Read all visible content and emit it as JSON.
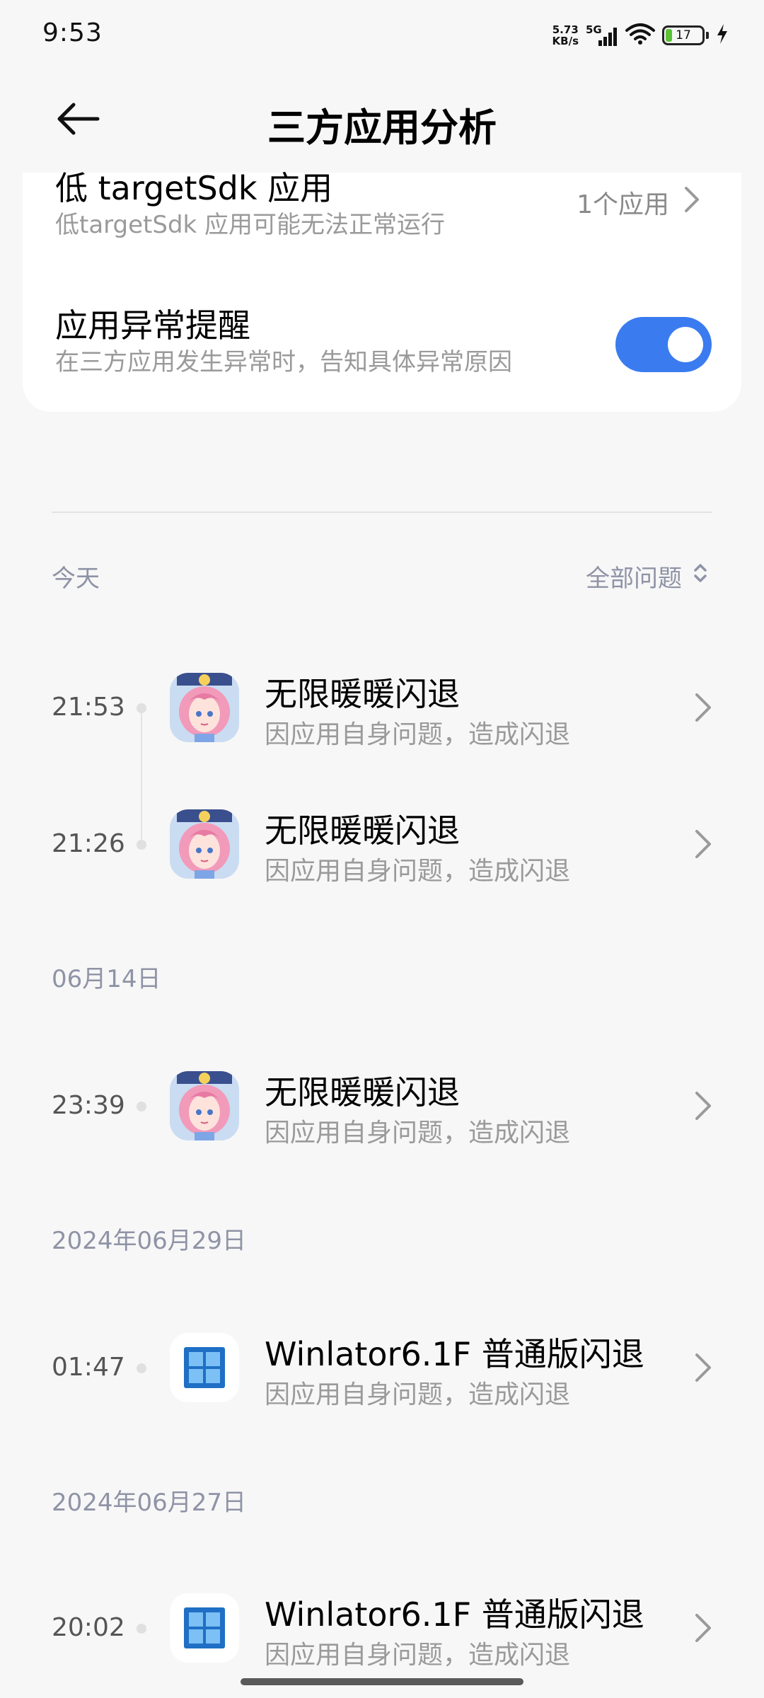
{
  "status_bar": {
    "time": "9:53",
    "net_speed_value": "5.73",
    "net_speed_unit": "KB/s",
    "network": "5G",
    "battery_level": "17",
    "battery_fraction": 0.17,
    "icons": [
      "signal-icon",
      "wifi-icon",
      "battery-icon",
      "charging-icon"
    ]
  },
  "header": {
    "title": "三方应用分析",
    "back_icon": "back-arrow-icon"
  },
  "settings": {
    "low_sdk": {
      "title": "低 targetSdk 应用",
      "subtitle": "低targetSdk 应用可能无法正常运行",
      "value": "1个应用"
    },
    "abnormal_alert": {
      "title": "应用异常提醒",
      "subtitle": "在三方应用发生异常时，告知具体异常原因",
      "enabled": true
    }
  },
  "filter": {
    "label": "全部问题"
  },
  "groups": [
    {
      "date": "今天",
      "entries": [
        {
          "time": "21:53",
          "title": "无限暖暖闪退",
          "subtitle": "因应用自身问题，造成闪退",
          "icon": "infinity-nikki-app-icon"
        },
        {
          "time": "21:26",
          "title": "无限暖暖闪退",
          "subtitle": "因应用自身问题，造成闪退",
          "icon": "infinity-nikki-app-icon"
        }
      ]
    },
    {
      "date": "06月14日",
      "entries": [
        {
          "time": "23:39",
          "title": "无限暖暖闪退",
          "subtitle": "因应用自身问题，造成闪退",
          "icon": "infinity-nikki-app-icon"
        }
      ]
    },
    {
      "date": "2024年06月29日",
      "entries": [
        {
          "time": "01:47",
          "title": "Winlator6.1F 普通版闪退",
          "subtitle": "因应用自身问题，造成闪退",
          "icon": "winlator-app-icon"
        }
      ]
    },
    {
      "date": "2024年06月27日",
      "entries": [
        {
          "time": "20:02",
          "title": "Winlator6.1F 普通版闪退",
          "subtitle": "因应用自身问题，造成闪退",
          "icon": "winlator-app-icon"
        }
      ]
    }
  ],
  "colors": {
    "background": "#f7f7f7",
    "card": "#ffffff",
    "accent": "#3a7bf0",
    "date_label": "#8f93a6",
    "subtitle": "#9a9a9a"
  }
}
